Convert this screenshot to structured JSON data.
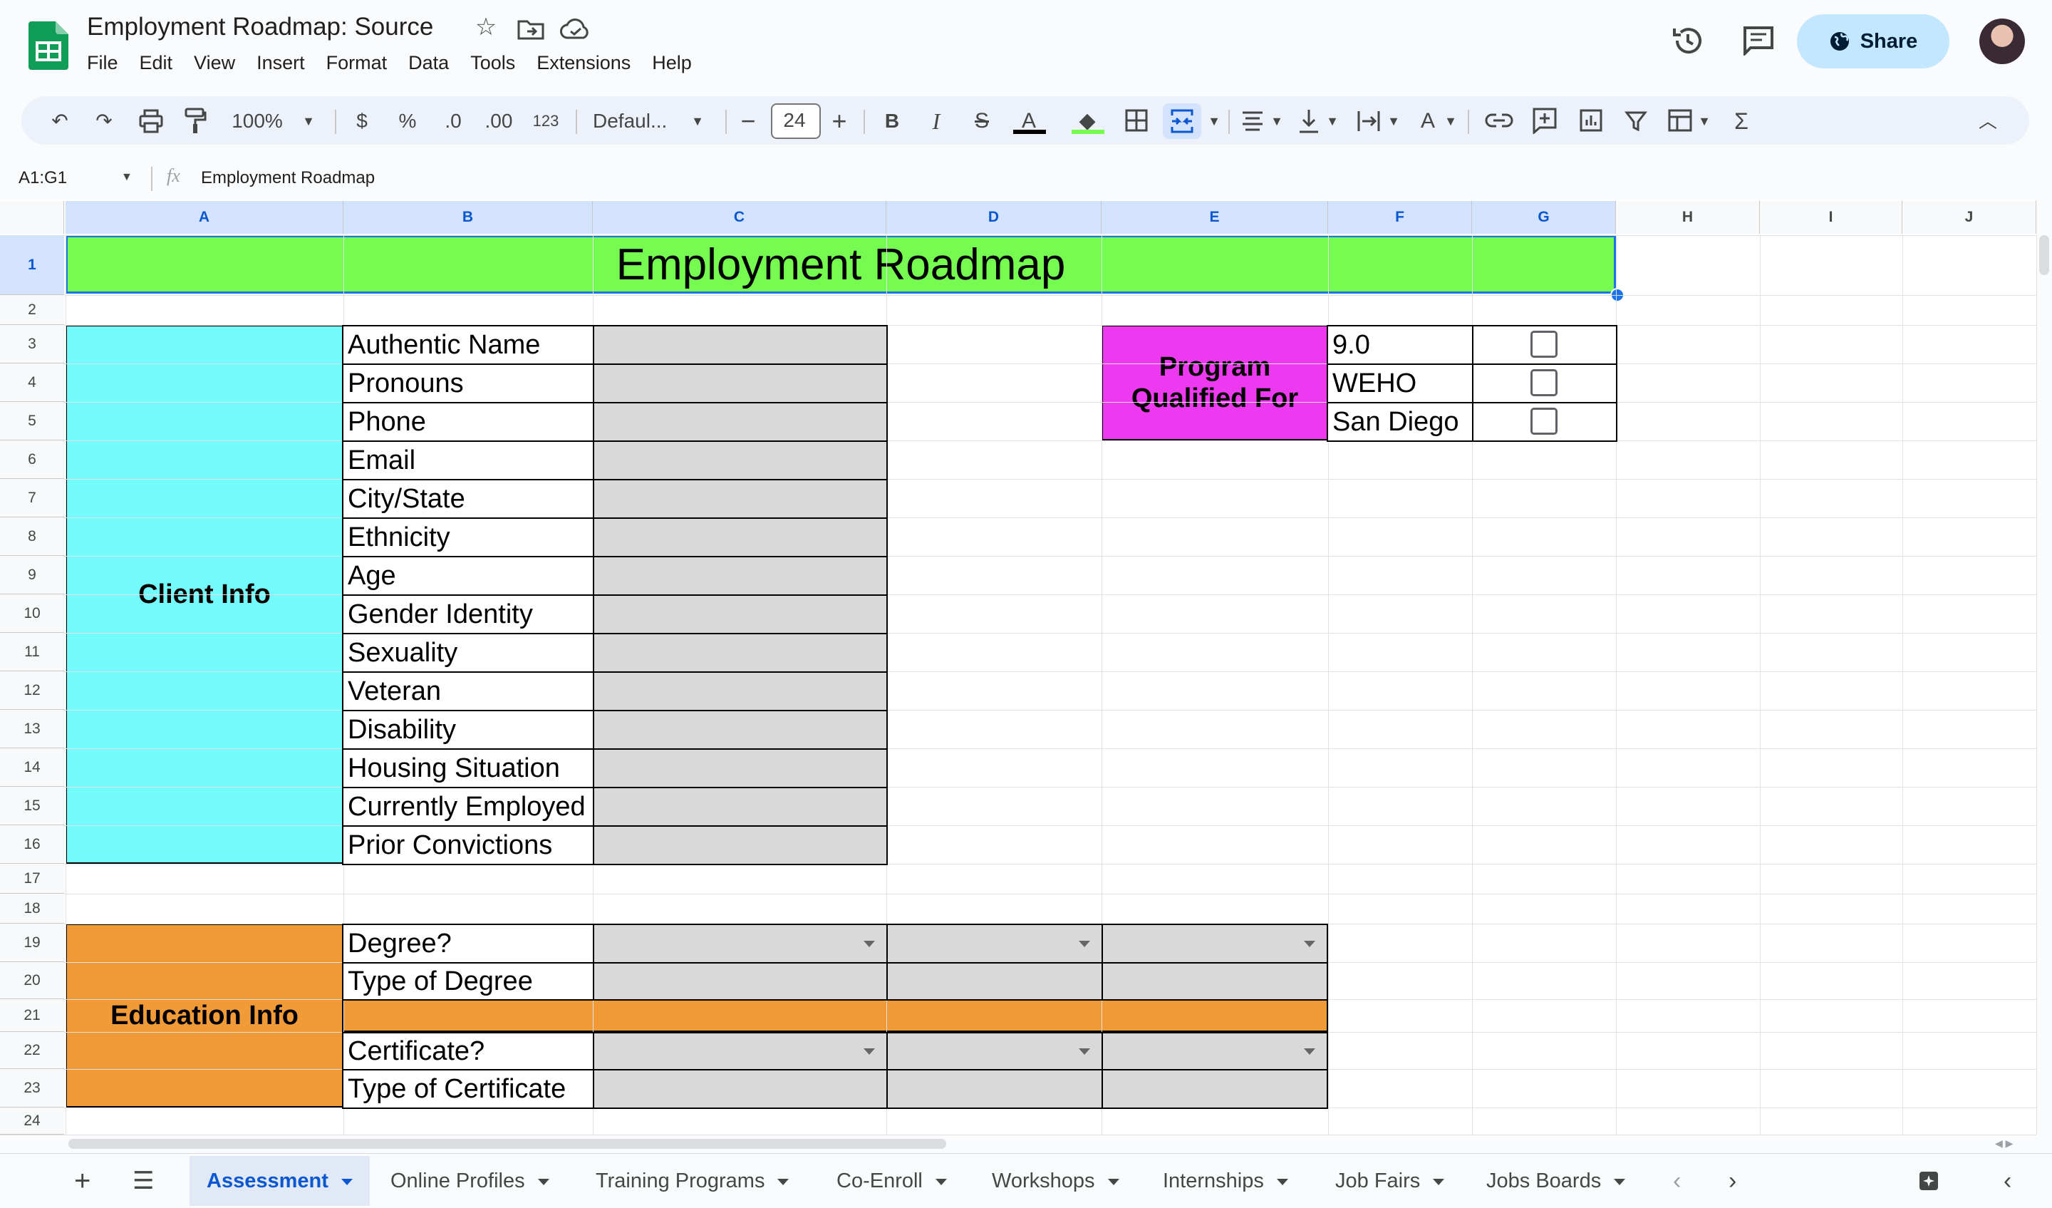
{
  "app": {
    "title": "Employment Roadmap: Source"
  },
  "menu": [
    "File",
    "Edit",
    "View",
    "Insert",
    "Format",
    "Data",
    "Tools",
    "Extensions",
    "Help"
  ],
  "share_label": "Share",
  "toolbar": {
    "zoom": "100%",
    "currency": "$",
    "percent": "%",
    "dec_decrease": ".0",
    "dec_increase": ".00",
    "number_format": "123",
    "font": "Defaul...",
    "font_size": "24",
    "bold": "B",
    "italic": "I"
  },
  "formula_bar": {
    "name_box": "A1:G1",
    "fx": "fx",
    "content": "Employment Roadmap"
  },
  "columns": [
    "A",
    "B",
    "C",
    "D",
    "E",
    "F",
    "G",
    "H",
    "I",
    "J"
  ],
  "rows": [
    "1",
    "2",
    "3",
    "4",
    "5",
    "6",
    "7",
    "8",
    "9",
    "10",
    "11",
    "12",
    "13",
    "14",
    "15",
    "16",
    "17",
    "18",
    "19",
    "20",
    "21",
    "22",
    "23",
    "24"
  ],
  "sheet": {
    "title": "Employment Roadmap",
    "client_section": "Client Info",
    "client_fields": [
      "Authentic Name",
      "Pronouns",
      "Phone",
      "Email",
      "City/State",
      "Ethnicity",
      "Age",
      "Gender Identity",
      "Sexuality",
      "Veteran",
      "Disability",
      "Housing Situation",
      "Currently Employed",
      "Prior Convictions"
    ],
    "program_label": "Program Qualified For",
    "programs": [
      "9.0",
      "WEHO",
      "San Diego"
    ],
    "education_section": "Education Info",
    "education_fields": [
      "Degree?",
      "Type of Degree",
      "Certificate?",
      "Type of Certificate"
    ]
  },
  "colors": {
    "title_bg": "#76fc50",
    "client_bg": "#74fcfc",
    "program_bg": "#ed3af1",
    "education_bg": "#f09b37",
    "value_bg": "#d9d9d9",
    "selection": "#1a73e8"
  },
  "tabs": [
    "Assessment",
    "Online Profiles",
    "Training Programs",
    "Co-Enroll",
    "Workshops",
    "Internships",
    "Job Fairs",
    "Jobs Boards"
  ]
}
